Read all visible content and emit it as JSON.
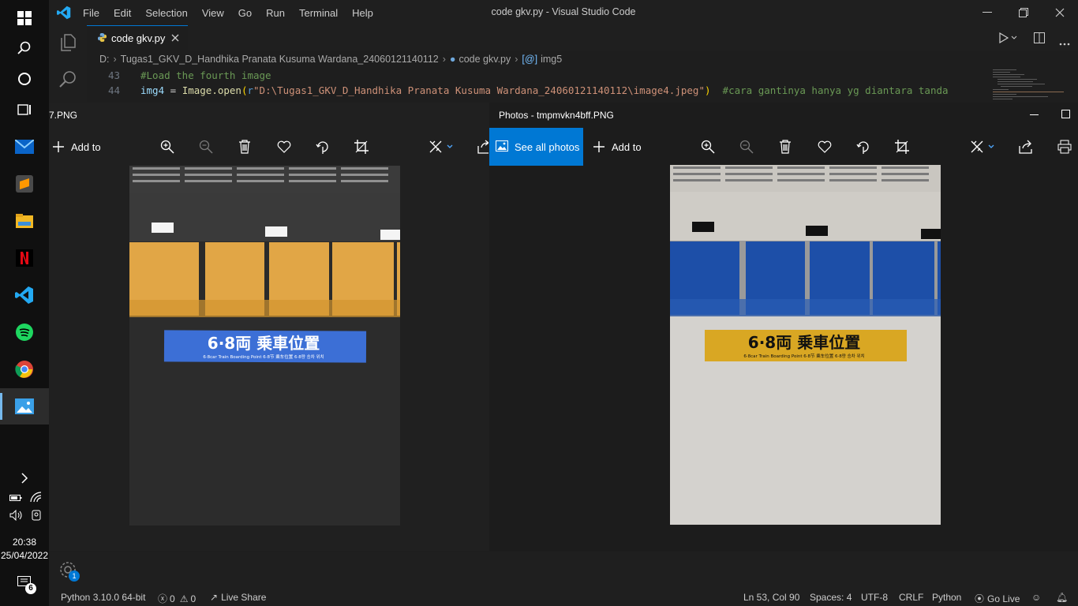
{
  "taskbar": {
    "time": "20:38",
    "date": "25/04/2022",
    "notification_count": "6"
  },
  "vscode": {
    "menu": [
      "File",
      "Edit",
      "Selection",
      "View",
      "Go",
      "Run",
      "Terminal",
      "Help"
    ],
    "window_title": "code gkv.py - Visual Studio Code",
    "tab_label": "code gkv.py",
    "breadcrumb": {
      "drive": "D:",
      "folder": "Tugas1_GKV_D_Handhika Pranata Kusuma Wardana_24060121140112",
      "file": "code gkv.py",
      "symbol": "img5"
    },
    "code_lines": [
      {
        "num": "43",
        "text": "#Load the fourth image"
      },
      {
        "num": "44",
        "text_var": "img4",
        "text_eq": " = ",
        "text_fn": "Image.open",
        "text_paren": "(",
        "text_r": "r",
        "text_str": "\"D:\\Tugas1_GKV_D_Handhika Pranata Kusuma Wardana_24060121140112\\image4.jpeg\"",
        "text_close": ")",
        "text_comment": "  #cara gantinya hanya yg diantara tanda"
      }
    ]
  },
  "photos_left": {
    "title": "7.PNG",
    "add_to": "Add to"
  },
  "photos_right": {
    "title": "Photos - tmpmvkn4bff.PNG",
    "see_all": "See all photos",
    "add_to": "Add to"
  },
  "signs": {
    "main": "6·8両 乗車位置",
    "sub": "6·8car Train Boarding Point   6·8节  乘车位置   6·8량 승차 위치"
  },
  "statusbar": {
    "python": "Python 3.10.0 64-bit",
    "errors": "0",
    "warnings": "0",
    "live_share": "Live Share",
    "position": "Ln 53, Col 90",
    "spaces": "Spaces: 4",
    "encoding": "UTF-8",
    "eol": "CRLF",
    "language": "Python",
    "go_live": "Go Live",
    "settings_badge": "1"
  },
  "colors": {
    "accent": "#0078d4",
    "yellow_tile": "#e1a646",
    "blue_tile": "#1d4fa8",
    "blue_sign": "#3c6fd6",
    "yellow_sign": "#d9a723"
  }
}
